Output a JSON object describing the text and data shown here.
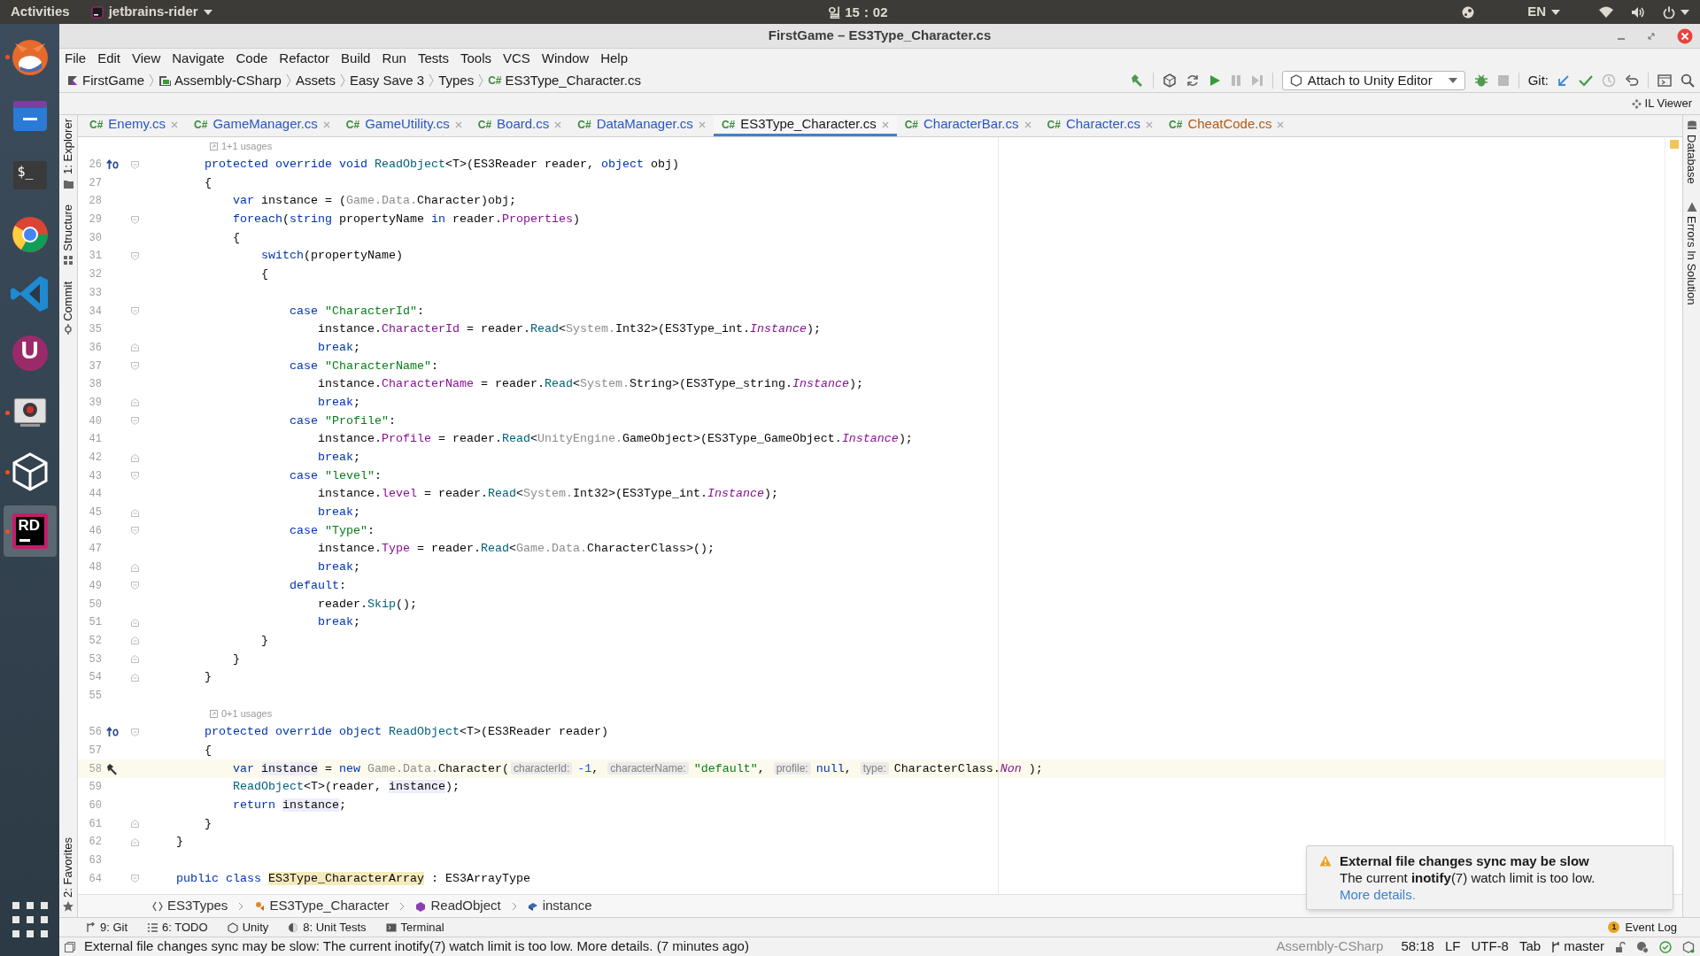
{
  "top_bar": {
    "activities": "Activities",
    "app": "jetbrains-rider",
    "clock": "일 15：02",
    "language": "EN"
  },
  "dock": [
    {
      "kind": "fox",
      "running": true,
      "selected": false
    },
    {
      "kind": "folder",
      "running": false,
      "selected": false
    },
    {
      "kind": "terminal",
      "label": "$_",
      "running": false,
      "selected": false
    },
    {
      "kind": "ring",
      "running": false,
      "selected": false
    },
    {
      "kind": "code",
      "running": false,
      "selected": false
    },
    {
      "kind": "letter",
      "label": "U",
      "running": false,
      "selected": false
    },
    {
      "kind": "screen",
      "running": true,
      "selected": false
    },
    {
      "kind": "unity",
      "running": true,
      "selected": false
    },
    {
      "kind": "rider",
      "label": "RD",
      "running": true,
      "selected": true
    },
    {
      "kind": "grid",
      "running": false,
      "selected": false
    }
  ],
  "window": {
    "title": "FirstGame – ES3Type_Character.cs"
  },
  "menu": [
    "File",
    "Edit",
    "View",
    "Navigate",
    "Code",
    "Refactor",
    "Build",
    "Run",
    "Tests",
    "Tools",
    "VCS",
    "Window",
    "Help"
  ],
  "breadcrumbs": [
    {
      "kind": "solution",
      "label": "FirstGame"
    },
    {
      "kind": "project",
      "label": "Assembly-CSharp"
    },
    {
      "kind": "folder",
      "label": "Assets"
    },
    {
      "kind": "folder",
      "label": "Easy Save 3"
    },
    {
      "kind": "folder",
      "label": "Types"
    },
    {
      "kind": "file",
      "prefix": "C#",
      "label": "ES3Type_Character.cs"
    }
  ],
  "toolbar": {
    "run_config": "Attach to Unity Editor",
    "git_label": "Git:"
  },
  "il_viewer": "IL Viewer",
  "tabs": [
    {
      "prefix": "C#",
      "label": "Enemy.cs",
      "selected": false,
      "color": "#2a56c6"
    },
    {
      "prefix": "C#",
      "label": "GameManager.cs",
      "selected": false,
      "color": "#2a56c6"
    },
    {
      "prefix": "C#",
      "label": "GameUtility.cs",
      "selected": false,
      "color": "#2a56c6"
    },
    {
      "prefix": "C#",
      "label": "Board.cs",
      "selected": false,
      "color": "#2a56c6"
    },
    {
      "prefix": "C#",
      "label": "DataManager.cs",
      "selected": false,
      "color": "#2a56c6"
    },
    {
      "prefix": "C#",
      "label": "ES3Type_Character.cs",
      "selected": true,
      "color": "#1a1a1a"
    },
    {
      "prefix": "C#",
      "label": "CharacterBar.cs",
      "selected": false,
      "color": "#2a56c6"
    },
    {
      "prefix": "C#",
      "label": "Character.cs",
      "selected": false,
      "color": "#2a56c6"
    },
    {
      "prefix": "C#",
      "label": "CheatCode.cs",
      "selected": false,
      "color": "#b55a12"
    }
  ],
  "left_tools": [
    "1: Explorer",
    "Structure",
    "Commit"
  ],
  "favorites": "2: Favorites",
  "right_tools": [
    "Database",
    "Errors In Solution"
  ],
  "editor": {
    "lines": [
      {
        "kind": "usages",
        "text": "1+1 usages"
      },
      {
        "kind": "code",
        "number": "26",
        "marker": {
          "kind": "override"
        },
        "fold": {
          "kind": "start"
        },
        "current": false,
        "tokens": [
          {
            "kind": "kw",
            "text": "        protected override void "
          },
          {
            "kind": "method",
            "text": "ReadObject"
          },
          {
            "kind": "plain",
            "text": "<T>(ES3Reader reader, "
          },
          {
            "kind": "kw",
            "text": "object"
          },
          {
            "kind": "plain",
            "text": " obj)"
          }
        ]
      },
      {
        "kind": "code",
        "number": "27",
        "current": false,
        "tokens": [
          {
            "kind": "plain",
            "text": "        {"
          }
        ]
      },
      {
        "kind": "code",
        "number": "28",
        "current": false,
        "tokens": [
          {
            "kind": "kw",
            "text": "            var"
          },
          {
            "kind": "plain",
            "text": " instance = ("
          },
          {
            "kind": "ns",
            "text": "Game.Data."
          },
          {
            "kind": "plain",
            "text": "Character)obj;"
          }
        ]
      },
      {
        "kind": "code",
        "number": "29",
        "fold": {
          "kind": "start"
        },
        "current": false,
        "tokens": [
          {
            "kind": "kw",
            "text": "            foreach"
          },
          {
            "kind": "plain",
            "text": "("
          },
          {
            "kind": "kw",
            "text": "string"
          },
          {
            "kind": "plain",
            "text": " propertyName "
          },
          {
            "kind": "kw",
            "text": "in"
          },
          {
            "kind": "plain",
            "text": " reader."
          },
          {
            "kind": "member",
            "text": "Properties"
          },
          {
            "kind": "plain",
            "text": ")"
          }
        ]
      },
      {
        "kind": "code",
        "number": "30",
        "current": false,
        "tokens": [
          {
            "kind": "plain",
            "text": "            {"
          }
        ]
      },
      {
        "kind": "code",
        "number": "31",
        "fold": {
          "kind": "start"
        },
        "current": false,
        "tokens": [
          {
            "kind": "kw",
            "text": "                switch"
          },
          {
            "kind": "plain",
            "text": "(propertyName)"
          }
        ]
      },
      {
        "kind": "code",
        "number": "32",
        "current": false,
        "tokens": [
          {
            "kind": "plain",
            "text": "                {"
          }
        ]
      },
      {
        "kind": "code",
        "number": "33",
        "current": false
      },
      {
        "kind": "code",
        "number": "34",
        "fold": {
          "kind": "start"
        },
        "current": false,
        "tokens": [
          {
            "kind": "kw",
            "text": "                    case "
          },
          {
            "kind": "string",
            "text": "\"CharacterId\""
          },
          {
            "kind": "plain",
            "text": ":"
          }
        ]
      },
      {
        "kind": "code",
        "number": "35",
        "current": false,
        "tokens": [
          {
            "kind": "plain",
            "text": "                        instance."
          },
          {
            "kind": "member",
            "text": "CharacterId"
          },
          {
            "kind": "plain",
            "text": " = reader."
          },
          {
            "kind": "method",
            "text": "Read"
          },
          {
            "kind": "plain",
            "text": "<"
          },
          {
            "kind": "ns",
            "text": "System."
          },
          {
            "kind": "plain",
            "text": "Int32>(ES3Type_int."
          },
          {
            "kind": "static",
            "text": "Instance"
          },
          {
            "kind": "plain",
            "text": ");"
          }
        ]
      },
      {
        "kind": "code",
        "number": "36",
        "fold": {
          "kind": "end"
        },
        "current": false,
        "tokens": [
          {
            "kind": "kw",
            "text": "                        break"
          },
          {
            "kind": "plain",
            "text": ";"
          }
        ]
      },
      {
        "kind": "code",
        "number": "37",
        "fold": {
          "kind": "start"
        },
        "current": false,
        "tokens": [
          {
            "kind": "kw",
            "text": "                    case "
          },
          {
            "kind": "string",
            "text": "\"CharacterName\""
          },
          {
            "kind": "plain",
            "text": ":"
          }
        ]
      },
      {
        "kind": "code",
        "number": "38",
        "current": false,
        "tokens": [
          {
            "kind": "plain",
            "text": "                        instance."
          },
          {
            "kind": "member",
            "text": "CharacterName"
          },
          {
            "kind": "plain",
            "text": " = reader."
          },
          {
            "kind": "method",
            "text": "Read"
          },
          {
            "kind": "plain",
            "text": "<"
          },
          {
            "kind": "ns",
            "text": "System."
          },
          {
            "kind": "plain",
            "text": "String>(ES3Type_string."
          },
          {
            "kind": "static",
            "text": "Instance"
          },
          {
            "kind": "plain",
            "text": ");"
          }
        ]
      },
      {
        "kind": "code",
        "number": "39",
        "fold": {
          "kind": "end"
        },
        "current": false,
        "tokens": [
          {
            "kind": "kw",
            "text": "                        break"
          },
          {
            "kind": "plain",
            "text": ";"
          }
        ]
      },
      {
        "kind": "code",
        "number": "40",
        "fold": {
          "kind": "start"
        },
        "current": false,
        "tokens": [
          {
            "kind": "kw",
            "text": "                    case "
          },
          {
            "kind": "string",
            "text": "\"Profile\""
          },
          {
            "kind": "plain",
            "text": ":"
          }
        ]
      },
      {
        "kind": "code",
        "number": "41",
        "current": false,
        "tokens": [
          {
            "kind": "plain",
            "text": "                        instance."
          },
          {
            "kind": "member",
            "text": "Profile"
          },
          {
            "kind": "plain",
            "text": " = reader."
          },
          {
            "kind": "method",
            "text": "Read"
          },
          {
            "kind": "plain",
            "text": "<"
          },
          {
            "kind": "ns",
            "text": "UnityEngine."
          },
          {
            "kind": "plain",
            "text": "GameObject>(ES3Type_GameObject."
          },
          {
            "kind": "static",
            "text": "Instance"
          },
          {
            "kind": "plain",
            "text": ");"
          }
        ]
      },
      {
        "kind": "code",
        "number": "42",
        "fold": {
          "kind": "end"
        },
        "current": false,
        "tokens": [
          {
            "kind": "kw",
            "text": "                        break"
          },
          {
            "kind": "plain",
            "text": ";"
          }
        ]
      },
      {
        "kind": "code",
        "number": "43",
        "fold": {
          "kind": "start"
        },
        "current": false,
        "tokens": [
          {
            "kind": "kw",
            "text": "                    case "
          },
          {
            "kind": "string",
            "text": "\"level\""
          },
          {
            "kind": "plain",
            "text": ":"
          }
        ]
      },
      {
        "kind": "code",
        "number": "44",
        "current": false,
        "tokens": [
          {
            "kind": "plain",
            "text": "                        instance."
          },
          {
            "kind": "member",
            "text": "level"
          },
          {
            "kind": "plain",
            "text": " = reader."
          },
          {
            "kind": "method",
            "text": "Read"
          },
          {
            "kind": "plain",
            "text": "<"
          },
          {
            "kind": "ns",
            "text": "System."
          },
          {
            "kind": "plain",
            "text": "Int32>(ES3Type_int."
          },
          {
            "kind": "static",
            "text": "Instance"
          },
          {
            "kind": "plain",
            "text": ");"
          }
        ]
      },
      {
        "kind": "code",
        "number": "45",
        "fold": {
          "kind": "end"
        },
        "current": false,
        "tokens": [
          {
            "kind": "kw",
            "text": "                        break"
          },
          {
            "kind": "plain",
            "text": ";"
          }
        ]
      },
      {
        "kind": "code",
        "number": "46",
        "fold": {
          "kind": "start"
        },
        "current": false,
        "tokens": [
          {
            "kind": "kw",
            "text": "                    case "
          },
          {
            "kind": "string",
            "text": "\"Type\""
          },
          {
            "kind": "plain",
            "text": ":"
          }
        ]
      },
      {
        "kind": "code",
        "number": "47",
        "current": false,
        "tokens": [
          {
            "kind": "plain",
            "text": "                        instance."
          },
          {
            "kind": "member",
            "text": "Type"
          },
          {
            "kind": "plain",
            "text": " = reader."
          },
          {
            "kind": "method",
            "text": "Read"
          },
          {
            "kind": "plain",
            "text": "<"
          },
          {
            "kind": "ns",
            "text": "Game.Data."
          },
          {
            "kind": "plain",
            "text": "CharacterClass>();"
          }
        ]
      },
      {
        "kind": "code",
        "number": "48",
        "fold": {
          "kind": "end"
        },
        "current": false,
        "tokens": [
          {
            "kind": "kw",
            "text": "                        break"
          },
          {
            "kind": "plain",
            "text": ";"
          }
        ]
      },
      {
        "kind": "code",
        "number": "49",
        "fold": {
          "kind": "start"
        },
        "current": false,
        "tokens": [
          {
            "kind": "kw",
            "text": "                    default"
          },
          {
            "kind": "plain",
            "text": ":"
          }
        ]
      },
      {
        "kind": "code",
        "number": "50",
        "current": false,
        "tokens": [
          {
            "kind": "plain",
            "text": "                        reader."
          },
          {
            "kind": "method",
            "text": "Skip"
          },
          {
            "kind": "plain",
            "text": "();"
          }
        ]
      },
      {
        "kind": "code",
        "number": "51",
        "fold": {
          "kind": "end"
        },
        "current": false,
        "tokens": [
          {
            "kind": "kw",
            "text": "                        break"
          },
          {
            "kind": "plain",
            "text": ";"
          }
        ]
      },
      {
        "kind": "code",
        "number": "52",
        "fold": {
          "kind": "end"
        },
        "current": false,
        "tokens": [
          {
            "kind": "plain",
            "text": "                }"
          }
        ]
      },
      {
        "kind": "code",
        "number": "53",
        "fold": {
          "kind": "end"
        },
        "current": false,
        "tokens": [
          {
            "kind": "plain",
            "text": "            }"
          }
        ]
      },
      {
        "kind": "code",
        "number": "54",
        "fold": {
          "kind": "end"
        },
        "current": false,
        "tokens": [
          {
            "kind": "plain",
            "text": "        }"
          }
        ]
      },
      {
        "kind": "code",
        "number": "55",
        "current": false
      },
      {
        "kind": "usages",
        "text": "0+1 usages"
      },
      {
        "kind": "code",
        "number": "56",
        "marker": {
          "kind": "override"
        },
        "fold": {
          "kind": "start"
        },
        "current": false,
        "tokens": [
          {
            "kind": "kw",
            "text": "        protected override object "
          },
          {
            "kind": "method",
            "text": "ReadObject"
          },
          {
            "kind": "plain",
            "text": "<T>(ES3Reader reader)"
          }
        ]
      },
      {
        "kind": "code",
        "number": "57",
        "current": false,
        "tokens": [
          {
            "kind": "plain",
            "text": "        {"
          }
        ]
      },
      {
        "kind": "code",
        "number": "58",
        "marker": {
          "kind": "hammer"
        },
        "current": true,
        "tokens": [
          {
            "kind": "kw",
            "text": "            var "
          },
          {
            "kind": "usage",
            "text": "instance"
          },
          {
            "kind": "plain",
            "text": " = "
          },
          {
            "kind": "kw",
            "text": "new "
          },
          {
            "kind": "ns",
            "text": "Game.Data."
          },
          {
            "kind": "plain",
            "text": "Character("
          },
          {
            "kind": "hint",
            "text": "characterId:"
          },
          {
            "kind": "number",
            "text": "-1"
          },
          {
            "kind": "plain",
            "text": ", "
          },
          {
            "kind": "hint",
            "text": "characterName:"
          },
          {
            "kind": "string",
            "text": "\"default\""
          },
          {
            "kind": "plain",
            "text": ", "
          },
          {
            "kind": "hint",
            "text": "profile:"
          },
          {
            "kind": "kw",
            "text": "null"
          },
          {
            "kind": "plain",
            "text": ", "
          },
          {
            "kind": "hint",
            "text": "type:"
          },
          {
            "kind": "plain",
            "text": "CharacterClass."
          },
          {
            "kind": "static",
            "text": "Non"
          },
          {
            "kind": "plain",
            "text": " );"
          }
        ]
      },
      {
        "kind": "code",
        "number": "59",
        "current": false,
        "tokens": [
          {
            "kind": "method",
            "text": "            ReadObject"
          },
          {
            "kind": "plain",
            "text": "<T>(reader, "
          },
          {
            "kind": "usage",
            "text": "instance"
          },
          {
            "kind": "plain",
            "text": ");"
          }
        ]
      },
      {
        "kind": "code",
        "number": "60",
        "current": false,
        "tokens": [
          {
            "kind": "kw",
            "text": "            return "
          },
          {
            "kind": "usage",
            "text": "instance"
          },
          {
            "kind": "plain",
            "text": ";"
          }
        ]
      },
      {
        "kind": "code",
        "number": "61",
        "fold": {
          "kind": "end"
        },
        "current": false,
        "tokens": [
          {
            "kind": "plain",
            "text": "        }"
          }
        ]
      },
      {
        "kind": "code",
        "number": "62",
        "fold": {
          "kind": "end"
        },
        "current": false,
        "tokens": [
          {
            "kind": "plain",
            "text": "    }"
          }
        ]
      },
      {
        "kind": "code",
        "number": "63",
        "current": false
      },
      {
        "kind": "code",
        "number": "64",
        "fold": {
          "kind": "start"
        },
        "current": false,
        "tokens": [
          {
            "kind": "kw",
            "text": "    public class "
          },
          {
            "kind": "warn",
            "text": "ES3Type_CharacterArray"
          },
          {
            "kind": "plain",
            "text": " : ES3ArrayType"
          }
        ]
      }
    ]
  },
  "code_breadcrumbs": [
    {
      "kind": "namespace",
      "label": "ES3Types"
    },
    {
      "kind": "class",
      "label": "ES3Type_Character"
    },
    {
      "kind": "method",
      "label": "ReadObject"
    },
    {
      "kind": "variable",
      "label": "instance"
    }
  ],
  "tool_windows": [
    {
      "kind": "git",
      "label": "9: Git"
    },
    {
      "kind": "todo",
      "label": "6: TODO"
    },
    {
      "kind": "unity",
      "label": "Unity"
    },
    {
      "kind": "tests",
      "label": "8: Unit Tests"
    },
    {
      "kind": "terminal",
      "label": "Terminal"
    }
  ],
  "event_log": {
    "badge": "1",
    "label": "Event Log"
  },
  "status_bar": {
    "message": "External file changes sync may be slow: The current inotify(7) watch limit is too low. More details. (7 minutes ago)",
    "project": "Assembly-CSharp",
    "position": "58:18",
    "line_ending": "LF",
    "encoding": "UTF-8",
    "indent": "Tab",
    "branch": "master"
  },
  "notification": {
    "title": "External file changes sync may be slow",
    "body": "The current **inotify**(7) watch limit is too low.",
    "link": "More details."
  }
}
